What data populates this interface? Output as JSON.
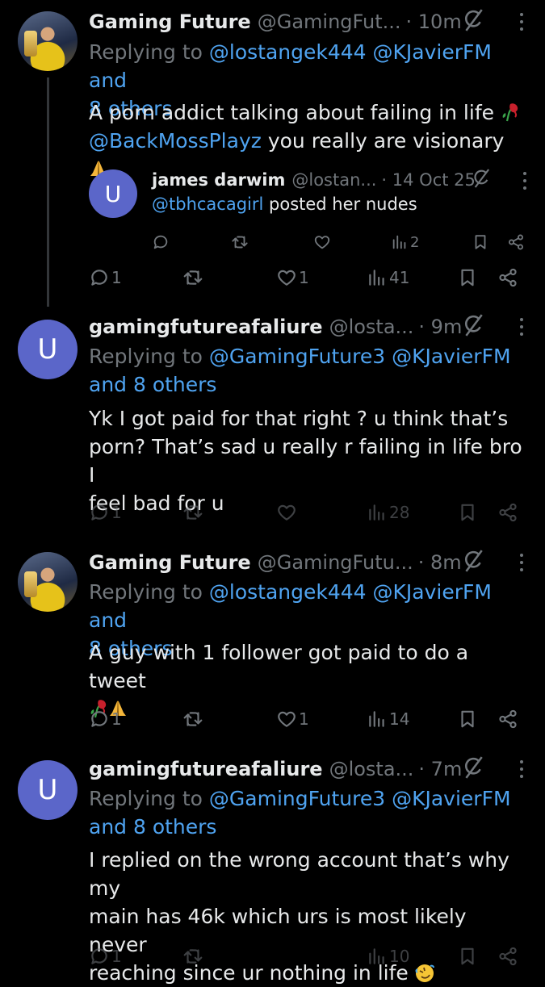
{
  "tweets": [
    {
      "name": "Gaming Future",
      "handle": "@GamingFut...",
      "time": "· 10m",
      "replying_label": "Replying to",
      "replying_targets": "@lostangek444 @KJavierFM and",
      "replying_others": "8 others",
      "text_line1": "A porn addict talking about failing in life",
      "mention": "@BackMossPlayz",
      "text_line2_rest": " you really are visionary",
      "quote": {
        "avatar_letter": "U",
        "name": "james darwim",
        "handle": "@lostan...",
        "time": "· 14 Oct 25",
        "mention": "@tbhcacagirl",
        "text_rest": " posted her nudes",
        "views": "2"
      },
      "counts": {
        "replies": "1",
        "likes": "1",
        "views": "41"
      }
    },
    {
      "avatar_letter": "U",
      "name": "gamingfutureafaliure",
      "handle": "@losta...",
      "time": "· 9m",
      "replying_label": "Replying to",
      "replying_targets": "@GamingFuture3 @KJavierFM",
      "replying_others": "and 8 others",
      "text_lines": [
        "Yk I got paid for that right ? u think that’s",
        "porn? That’s sad u really r failing in life bro I",
        "feel bad for u"
      ],
      "counts": {
        "replies": "1",
        "views": "28"
      }
    },
    {
      "name": "Gaming Future",
      "handle": "@GamingFutu...",
      "time": "· 8m",
      "replying_label": "Replying to",
      "replying_targets": "@lostangek444 @KJavierFM and",
      "replying_others": "8 others",
      "text_line1": "A guy with 1 follower got paid to do a tweet",
      "counts": {
        "replies": "1",
        "likes": "1",
        "views": "14"
      }
    },
    {
      "avatar_letter": "U",
      "name": "gamingfutureafaliure",
      "handle": "@losta...",
      "time": "· 7m",
      "replying_label": "Replying to",
      "replying_targets": "@GamingFuture3 @KJavierFM",
      "replying_others": "and 8 others",
      "text_lines": [
        "I replied on the wrong account that’s why my",
        "main has 46k which urs is most likely never",
        "reaching since ur nothing in life"
      ],
      "counts": {
        "replies": "1",
        "views": "10"
      }
    }
  ]
}
